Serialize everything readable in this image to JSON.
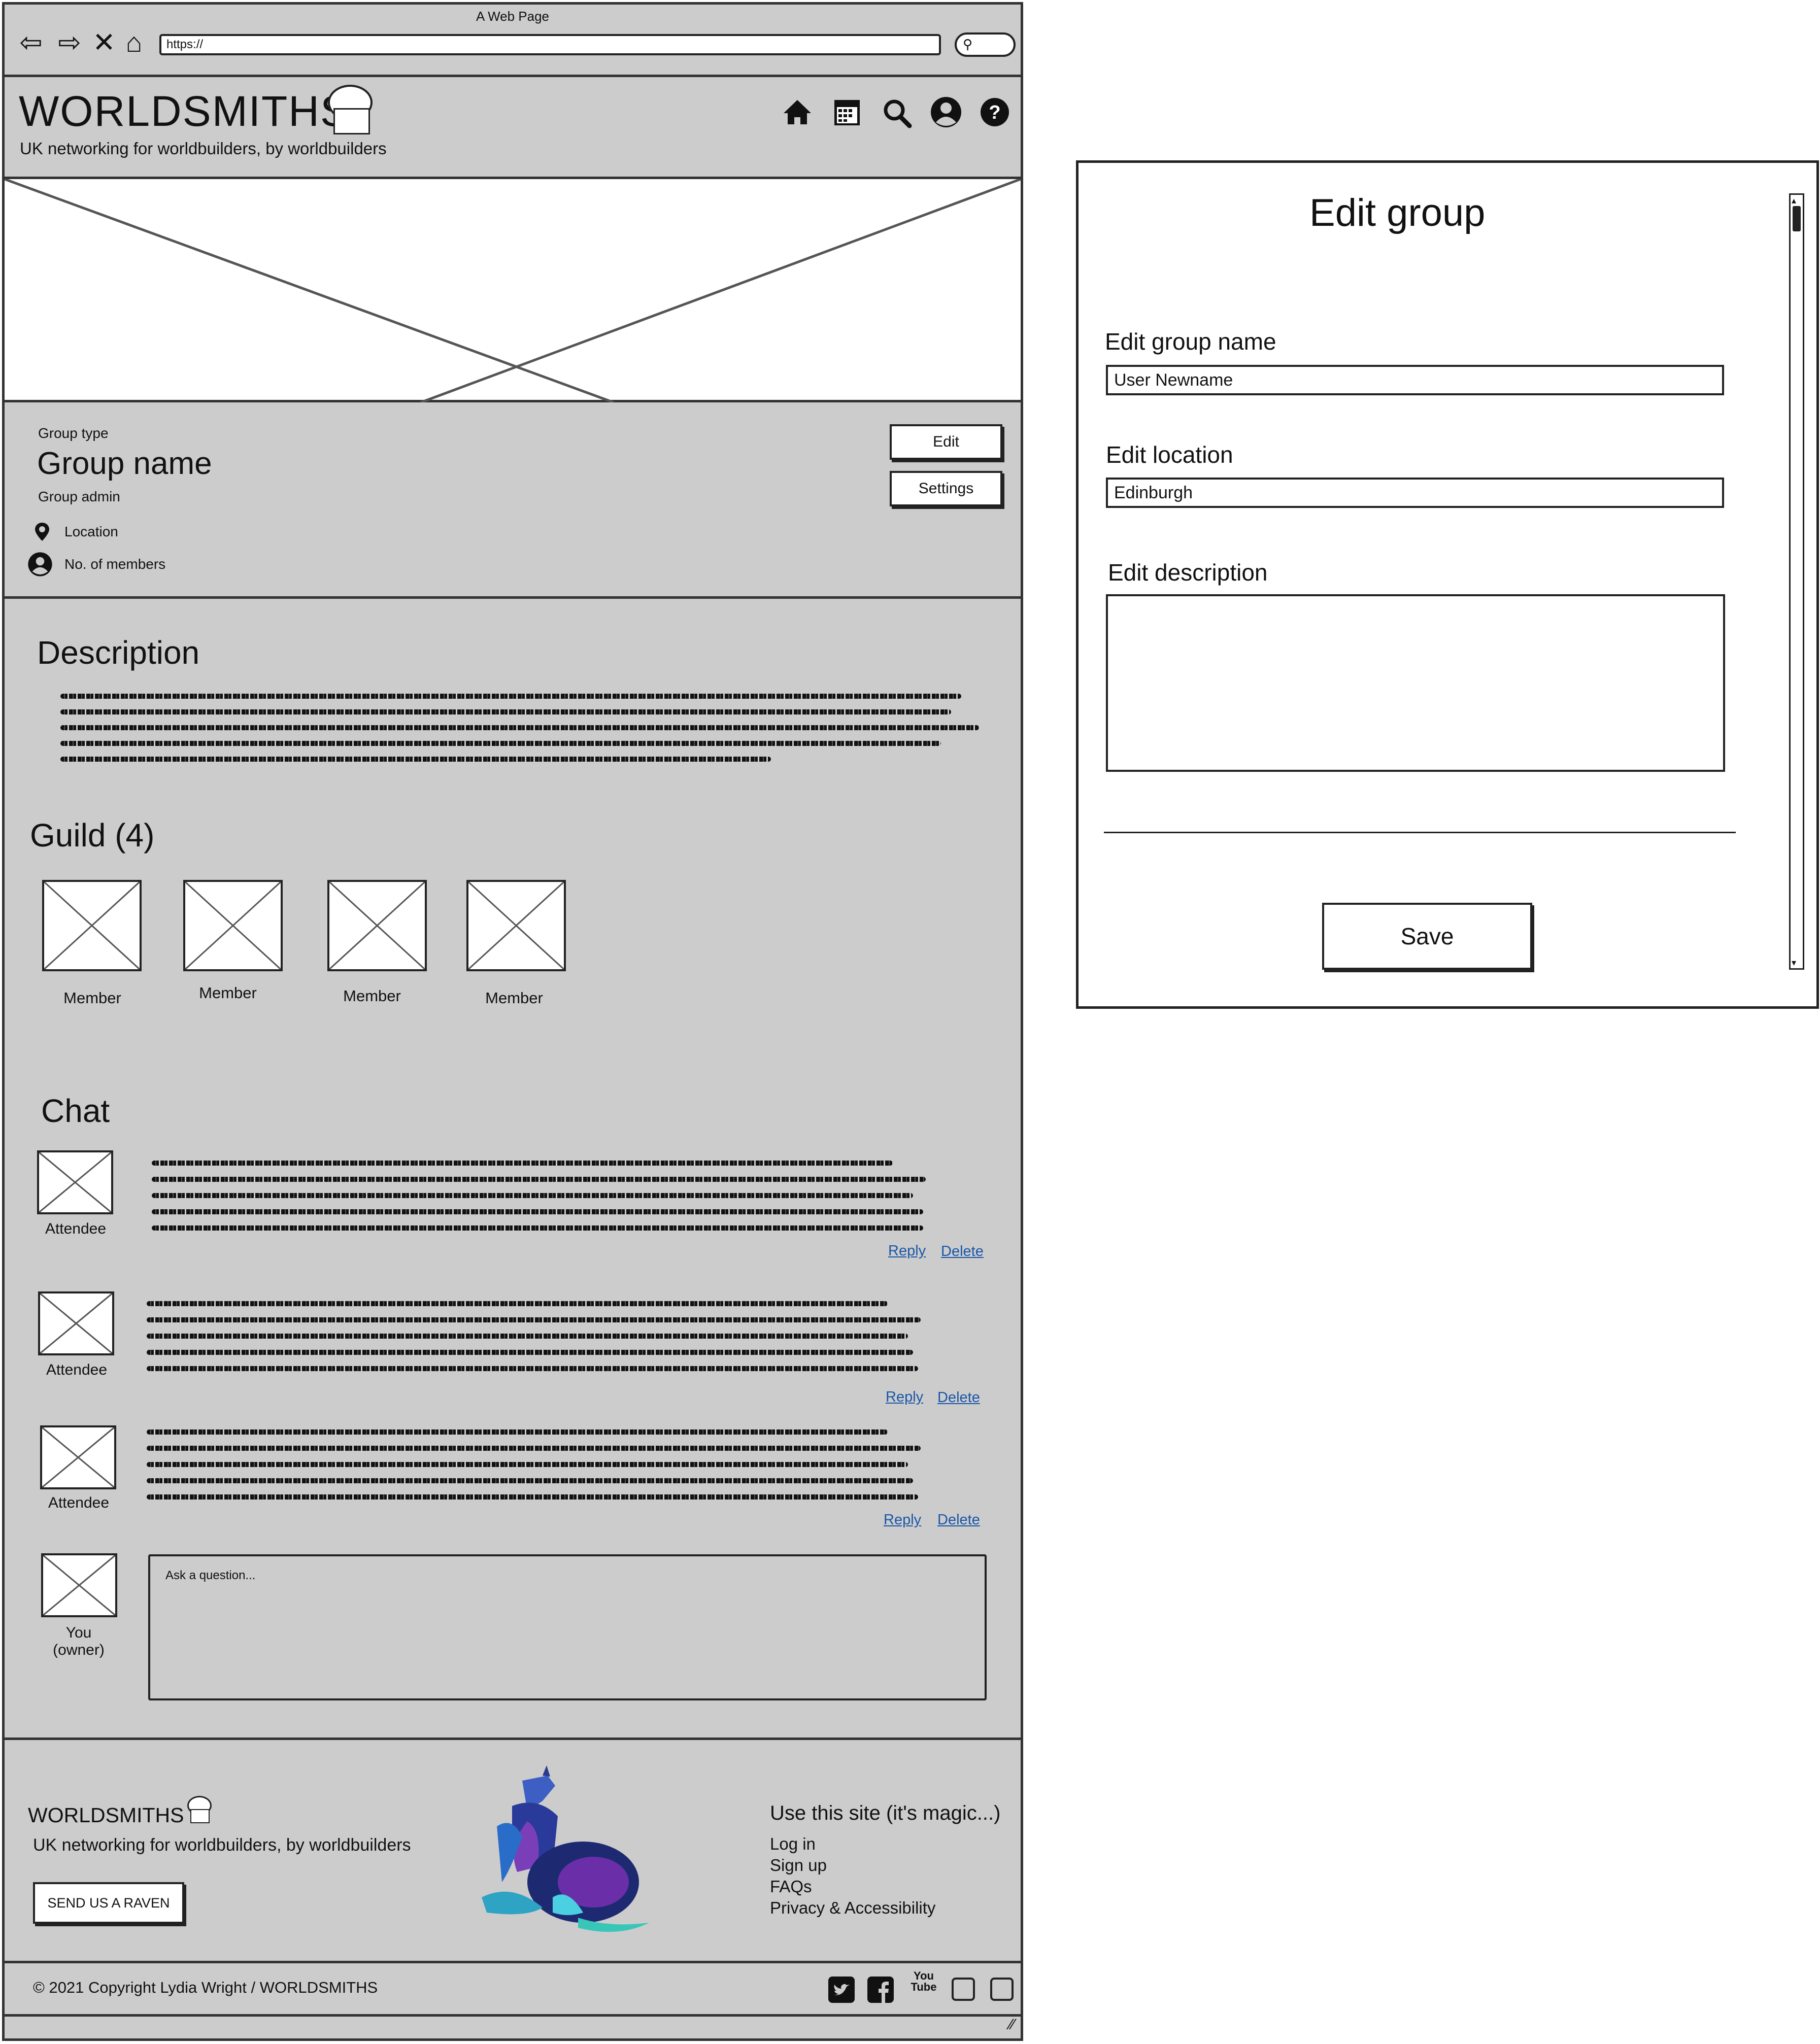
{
  "browser": {
    "window_title": "A Web Page",
    "url": "https://",
    "nav_icons": [
      "back-arrow-icon",
      "forward-arrow-icon",
      "close-x-icon",
      "home-outline-icon"
    ]
  },
  "site_header": {
    "logo": "WORLDSMITHS",
    "tagline": "UK networking for worldbuilders, by worldbuilders",
    "nav_icons": [
      "home-icon",
      "calendar-icon",
      "search-icon",
      "user-icon",
      "help-icon"
    ]
  },
  "group": {
    "type_label": "Group type",
    "name": "Group name",
    "admin_label": "Group admin",
    "location_label": "Location",
    "members_label": "No. of members",
    "edit_label": "Edit",
    "settings_label": "Settings"
  },
  "description": {
    "title": "Description"
  },
  "guild": {
    "title": "Guild (4)",
    "members": [
      "Member",
      "Member",
      "Member",
      "Member"
    ]
  },
  "chat": {
    "title": "Chat",
    "messages": [
      {
        "author": "Attendee",
        "reply": "Reply",
        "delete": "Delete"
      },
      {
        "author": "Attendee",
        "reply": "Reply",
        "delete": "Delete"
      },
      {
        "author": "Attendee",
        "reply": "Reply",
        "delete": "Delete"
      }
    ],
    "you_label_line1": "You",
    "you_label_line2": "(owner)",
    "ask_placeholder": "Ask a question..."
  },
  "footer": {
    "logo": "WORLDSMITHS",
    "tagline": "UK networking for worldbuilders, by worldbuilders",
    "raven_button": "SEND US A RAVEN",
    "links_title": "Use this site (it's magic...)",
    "links": [
      "Log in",
      "Sign up",
      "FAQs",
      "Privacy & Accessibility"
    ],
    "copyright": "© 2021 Copyright Lydia Wright / WORLDSMITHS",
    "social_icons": [
      "twitter-icon",
      "facebook-icon",
      "youtube-icon",
      "blank-social-icon",
      "blank-social-icon"
    ],
    "youtube_text": "You Tube"
  },
  "modal": {
    "title": "Edit group",
    "name_label": "Edit group name",
    "name_value": "User Newname",
    "location_label": "Edit location",
    "location_value": "Edinburgh",
    "description_label": "Edit description",
    "description_value": "",
    "save_label": "Save"
  },
  "colors": {
    "page_bg": "#cccccc",
    "line": "#222222",
    "link": "#1a56a8"
  }
}
